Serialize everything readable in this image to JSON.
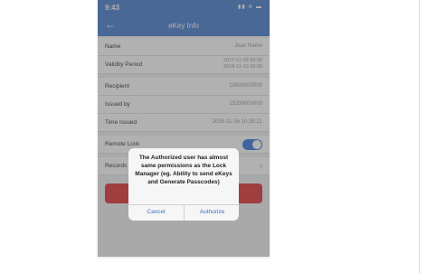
{
  "status_bar": {
    "time": "9:43",
    "icons": "▮▮ ≋ ▬"
  },
  "nav": {
    "back_glyph": "←",
    "title": "eKey Info"
  },
  "rows": {
    "name": {
      "label": "Name",
      "value": "Jean Name"
    },
    "validity": {
      "label": "Validity Period",
      "value_line1": "2017-11-09 09:00",
      "value_line2": "2018-11-10 09:00"
    },
    "recipient": {
      "label": "Recipient",
      "value": "18800000000"
    },
    "issued_by": {
      "label": "Issued by",
      "value": "15200000000"
    },
    "time_issued": {
      "label": "Time Issued",
      "value": "2016-11-16 10:26:21"
    },
    "remote_lock": {
      "label": "Remote Lock"
    },
    "records": {
      "label": "Records",
      "chevron": "›"
    }
  },
  "dialog": {
    "message": "The Authorized user has almost same permissions as the Lock Manager (eg. Ability to send eKeys and Generate Passcodes)",
    "cancel_label": "Cancel",
    "authorize_label": "Authorize"
  },
  "colors": {
    "nav_bg": "#4c82cf",
    "toggle_on": "#3d7be0",
    "danger": "#e0393a",
    "link": "#3d6fc4"
  }
}
